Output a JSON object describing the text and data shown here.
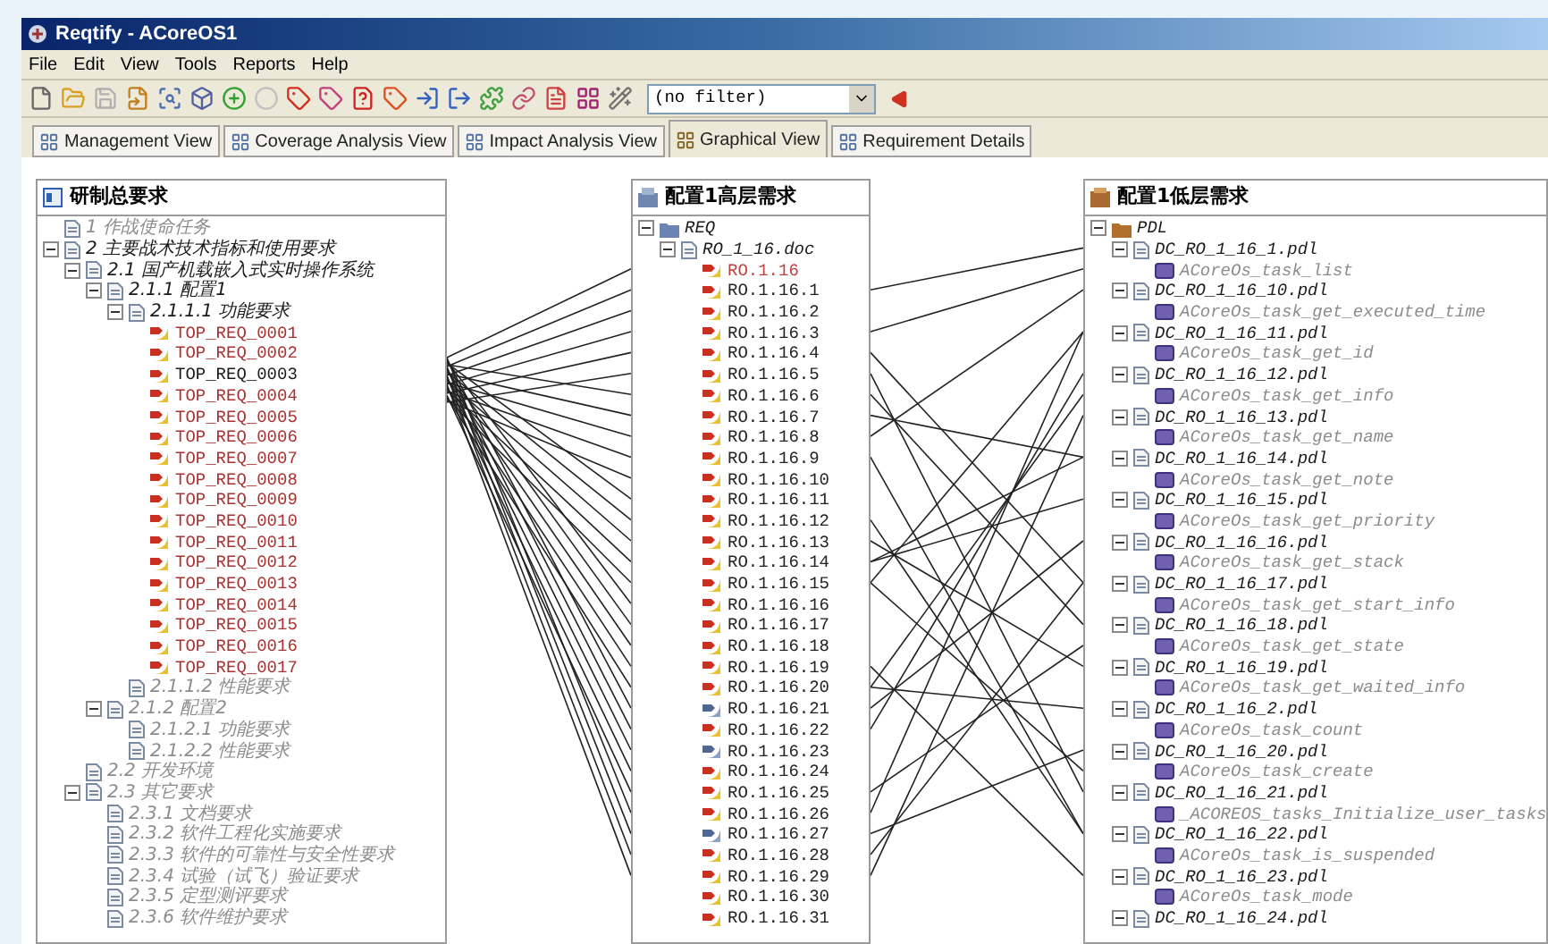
{
  "window": {
    "title": "Reqtify - ACoreOS1"
  },
  "menu": [
    "File",
    "Edit",
    "View",
    "Tools",
    "Reports",
    "Help"
  ],
  "toolbar": {
    "filter": "(no filter)"
  },
  "tabs": [
    {
      "label": "Management View",
      "selected": false
    },
    {
      "label": "Coverage Analysis View",
      "selected": false
    },
    {
      "label": "Impact Analysis View",
      "selected": false
    },
    {
      "label": "Graphical View",
      "selected": true
    },
    {
      "label": "Requirement Details",
      "selected": false
    }
  ],
  "panels": [
    {
      "title": "研制总要求",
      "kind": "document",
      "tree": [
        {
          "label": "1 作战使命任务",
          "kind": "heading",
          "dimmed": true
        },
        {
          "label": "2 主要战术技术指标和使用要求",
          "kind": "heading",
          "dimmed": false,
          "expanded": true,
          "children": [
            {
              "label": "2.1 国产机载嵌入式实时操作系统",
              "kind": "heading",
              "dimmed": false,
              "expanded": true,
              "children": [
                {
                  "label": "2.1.1 配置1",
                  "kind": "heading",
                  "dimmed": false,
                  "expanded": true,
                  "children": [
                    {
                      "label": "2.1.1.1 功能要求",
                      "kind": "heading",
                      "dimmed": false,
                      "expanded": true,
                      "children": [
                        {
                          "label": "TOP_REQ_0001",
                          "kind": "req",
                          "color": "#a83232"
                        },
                        {
                          "label": "TOP_REQ_0002",
                          "kind": "req",
                          "color": "#a83232"
                        },
                        {
                          "label": "TOP_REQ_0003",
                          "kind": "req",
                          "color": "#1a1a1a"
                        },
                        {
                          "label": "TOP_REQ_0004",
                          "kind": "req",
                          "color": "#a83232"
                        },
                        {
                          "label": "TOP_REQ_0005",
                          "kind": "req",
                          "color": "#a83232"
                        },
                        {
                          "label": "TOP_REQ_0006",
                          "kind": "req",
                          "color": "#a83232"
                        },
                        {
                          "label": "TOP_REQ_0007",
                          "kind": "req",
                          "color": "#a83232"
                        },
                        {
                          "label": "TOP_REQ_0008",
                          "kind": "req",
                          "color": "#a83232"
                        },
                        {
                          "label": "TOP_REQ_0009",
                          "kind": "req",
                          "color": "#a83232"
                        },
                        {
                          "label": "TOP_REQ_0010",
                          "kind": "req",
                          "color": "#a83232"
                        },
                        {
                          "label": "TOP_REQ_0011",
                          "kind": "req",
                          "color": "#a83232"
                        },
                        {
                          "label": "TOP_REQ_0012",
                          "kind": "req",
                          "color": "#a83232"
                        },
                        {
                          "label": "TOP_REQ_0013",
                          "kind": "req",
                          "color": "#a83232"
                        },
                        {
                          "label": "TOP_REQ_0014",
                          "kind": "req",
                          "color": "#a83232"
                        },
                        {
                          "label": "TOP_REQ_0015",
                          "kind": "req",
                          "color": "#a83232"
                        },
                        {
                          "label": "TOP_REQ_0016",
                          "kind": "req",
                          "color": "#a83232"
                        },
                        {
                          "label": "TOP_REQ_0017",
                          "kind": "req",
                          "color": "#a83232"
                        }
                      ]
                    },
                    {
                      "label": "2.1.1.2 性能要求",
                      "kind": "heading",
                      "dimmed": true
                    }
                  ]
                },
                {
                  "label": "2.1.2 配置2",
                  "kind": "heading",
                  "dimmed": true,
                  "expanded": true,
                  "children": [
                    {
                      "label": "2.1.2.1 功能要求",
                      "kind": "heading",
                      "dimmed": true
                    },
                    {
                      "label": "2.1.2.2 性能要求",
                      "kind": "heading",
                      "dimmed": true
                    }
                  ]
                }
              ]
            },
            {
              "label": "2.2 开发环境",
              "kind": "heading",
              "dimmed": true
            },
            {
              "label": "2.3 其它要求",
              "kind": "heading",
              "dimmed": true,
              "expanded": true,
              "children": [
                {
                  "label": "2.3.1 文档要求",
                  "kind": "heading",
                  "dimmed": true
                },
                {
                  "label": "2.3.2 软件工程化实施要求",
                  "kind": "heading",
                  "dimmed": true
                },
                {
                  "label": "2.3.3 软件的可靠性与安全性要求",
                  "kind": "heading",
                  "dimmed": true
                },
                {
                  "label": "2.3.4 试验（试飞）验证要求",
                  "kind": "heading",
                  "dimmed": true
                },
                {
                  "label": "2.3.5 定型测评要求",
                  "kind": "heading",
                  "dimmed": true
                },
                {
                  "label": "2.3.6 软件维护要求",
                  "kind": "heading",
                  "dimmed": true
                }
              ]
            }
          ]
        }
      ]
    },
    {
      "title": "配置1高层需求",
      "kind": "database",
      "tree": [
        {
          "label": "REQ",
          "kind": "folder",
          "expanded": true,
          "children": [
            {
              "label": "RO_1_16.doc",
              "kind": "doc",
              "expanded": true,
              "children": [
                {
                  "label": "RO.1.16",
                  "kind": "req",
                  "color": "#c04040"
                },
                {
                  "label": "RO.1.16.1",
                  "kind": "req",
                  "color": "#222222"
                },
                {
                  "label": "RO.1.16.2",
                  "kind": "req",
                  "color": "#222222"
                },
                {
                  "label": "RO.1.16.3",
                  "kind": "req",
                  "color": "#222222"
                },
                {
                  "label": "RO.1.16.4",
                  "kind": "req",
                  "color": "#222222"
                },
                {
                  "label": "RO.1.16.5",
                  "kind": "req",
                  "color": "#222222"
                },
                {
                  "label": "RO.1.16.6",
                  "kind": "req",
                  "color": "#222222"
                },
                {
                  "label": "RO.1.16.7",
                  "kind": "req",
                  "color": "#222222"
                },
                {
                  "label": "RO.1.16.8",
                  "kind": "req",
                  "color": "#222222"
                },
                {
                  "label": "RO.1.16.9",
                  "kind": "req",
                  "color": "#222222"
                },
                {
                  "label": "RO.1.16.10",
                  "kind": "req",
                  "color": "#222222"
                },
                {
                  "label": "RO.1.16.11",
                  "kind": "req",
                  "color": "#222222"
                },
                {
                  "label": "RO.1.16.12",
                  "kind": "req",
                  "color": "#222222"
                },
                {
                  "label": "RO.1.16.13",
                  "kind": "req",
                  "color": "#222222"
                },
                {
                  "label": "RO.1.16.14",
                  "kind": "req",
                  "color": "#222222"
                },
                {
                  "label": "RO.1.16.15",
                  "kind": "req",
                  "color": "#222222"
                },
                {
                  "label": "RO.1.16.16",
                  "kind": "req",
                  "color": "#222222"
                },
                {
                  "label": "RO.1.16.17",
                  "kind": "req",
                  "color": "#222222"
                },
                {
                  "label": "RO.1.16.18",
                  "kind": "req",
                  "color": "#222222"
                },
                {
                  "label": "RO.1.16.19",
                  "kind": "req",
                  "color": "#222222"
                },
                {
                  "label": "RO.1.16.20",
                  "kind": "req",
                  "color": "#222222"
                },
                {
                  "label": "RO.1.16.21",
                  "kind": "req-linked",
                  "color": "#222222"
                },
                {
                  "label": "RO.1.16.22",
                  "kind": "req",
                  "color": "#222222"
                },
                {
                  "label": "RO.1.16.23",
                  "kind": "req-linked",
                  "color": "#222222"
                },
                {
                  "label": "RO.1.16.24",
                  "kind": "req",
                  "color": "#222222"
                },
                {
                  "label": "RO.1.16.25",
                  "kind": "req",
                  "color": "#222222"
                },
                {
                  "label": "RO.1.16.26",
                  "kind": "req",
                  "color": "#222222"
                },
                {
                  "label": "RO.1.16.27",
                  "kind": "req-linked",
                  "color": "#222222"
                },
                {
                  "label": "RO.1.16.28",
                  "kind": "req",
                  "color": "#222222"
                },
                {
                  "label": "RO.1.16.29",
                  "kind": "req",
                  "color": "#222222"
                },
                {
                  "label": "RO.1.16.30",
                  "kind": "req",
                  "color": "#222222"
                },
                {
                  "label": "RO.1.16.31",
                  "kind": "req",
                  "color": "#222222"
                }
              ]
            }
          ]
        }
      ]
    },
    {
      "title": "配置1低层需求",
      "kind": "pdl",
      "tree": [
        {
          "label": "PDL",
          "kind": "pdl-folder",
          "expanded": true,
          "children": [
            {
              "label": "DC_RO_1_16_1.pdl",
              "kind": "doc",
              "expanded": true,
              "children": [
                {
                  "label": "ACoreOs_task_list",
                  "kind": "function",
                  "dimmed": true
                }
              ]
            },
            {
              "label": "DC_RO_1_16_10.pdl",
              "kind": "doc",
              "expanded": true,
              "children": [
                {
                  "label": "ACoreOs_task_get_executed_time",
                  "kind": "function",
                  "dimmed": true
                }
              ]
            },
            {
              "label": "DC_RO_1_16_11.pdl",
              "kind": "doc",
              "expanded": true,
              "children": [
                {
                  "label": "ACoreOs_task_get_id",
                  "kind": "function",
                  "dimmed": true
                }
              ]
            },
            {
              "label": "DC_RO_1_16_12.pdl",
              "kind": "doc",
              "expanded": true,
              "children": [
                {
                  "label": "ACoreOs_task_get_info",
                  "kind": "function",
                  "dimmed": true
                }
              ]
            },
            {
              "label": "DC_RO_1_16_13.pdl",
              "kind": "doc",
              "expanded": true,
              "children": [
                {
                  "label": "ACoreOs_task_get_name",
                  "kind": "function",
                  "dimmed": true
                }
              ]
            },
            {
              "label": "DC_RO_1_16_14.pdl",
              "kind": "doc",
              "expanded": true,
              "children": [
                {
                  "label": "ACoreOs_task_get_note",
                  "kind": "function",
                  "dimmed": true
                }
              ]
            },
            {
              "label": "DC_RO_1_16_15.pdl",
              "kind": "doc",
              "expanded": true,
              "children": [
                {
                  "label": "ACoreOs_task_get_priority",
                  "kind": "function",
                  "dimmed": true
                }
              ]
            },
            {
              "label": "DC_RO_1_16_16.pdl",
              "kind": "doc",
              "expanded": true,
              "children": [
                {
                  "label": "ACoreOs_task_get_stack",
                  "kind": "function",
                  "dimmed": true
                }
              ]
            },
            {
              "label": "DC_RO_1_16_17.pdl",
              "kind": "doc",
              "expanded": true,
              "children": [
                {
                  "label": "ACoreOs_task_get_start_info",
                  "kind": "function",
                  "dimmed": true
                }
              ]
            },
            {
              "label": "DC_RO_1_16_18.pdl",
              "kind": "doc",
              "expanded": true,
              "children": [
                {
                  "label": "ACoreOs_task_get_state",
                  "kind": "function",
                  "dimmed": true
                }
              ]
            },
            {
              "label": "DC_RO_1_16_19.pdl",
              "kind": "doc",
              "expanded": true,
              "children": [
                {
                  "label": "ACoreOs_task_get_waited_info",
                  "kind": "function",
                  "dimmed": true
                }
              ]
            },
            {
              "label": "DC_RO_1_16_2.pdl",
              "kind": "doc",
              "expanded": true,
              "children": [
                {
                  "label": "ACoreOs_task_count",
                  "kind": "function",
                  "dimmed": true
                }
              ]
            },
            {
              "label": "DC_RO_1_16_20.pdl",
              "kind": "doc",
              "expanded": true,
              "children": [
                {
                  "label": "ACoreOs_task_create",
                  "kind": "function",
                  "dimmed": true
                }
              ]
            },
            {
              "label": "DC_RO_1_16_21.pdl",
              "kind": "doc",
              "expanded": true,
              "children": [
                {
                  "label": "_ACOREOS_tasks_Initialize_user_tasks",
                  "kind": "function",
                  "dimmed": true
                }
              ]
            },
            {
              "label": "DC_RO_1_16_22.pdl",
              "kind": "doc",
              "expanded": true,
              "children": [
                {
                  "label": "ACoreOs_task_is_suspended",
                  "kind": "function",
                  "dimmed": true
                }
              ]
            },
            {
              "label": "DC_RO_1_16_23.pdl",
              "kind": "doc",
              "expanded": true,
              "children": [
                {
                  "label": "ACoreOs_task_mode",
                  "kind": "function",
                  "dimmed": true
                }
              ]
            },
            {
              "label": "DC_RO_1_16_24.pdl",
              "kind": "doc",
              "expanded": true
            }
          ]
        }
      ]
    }
  ]
}
